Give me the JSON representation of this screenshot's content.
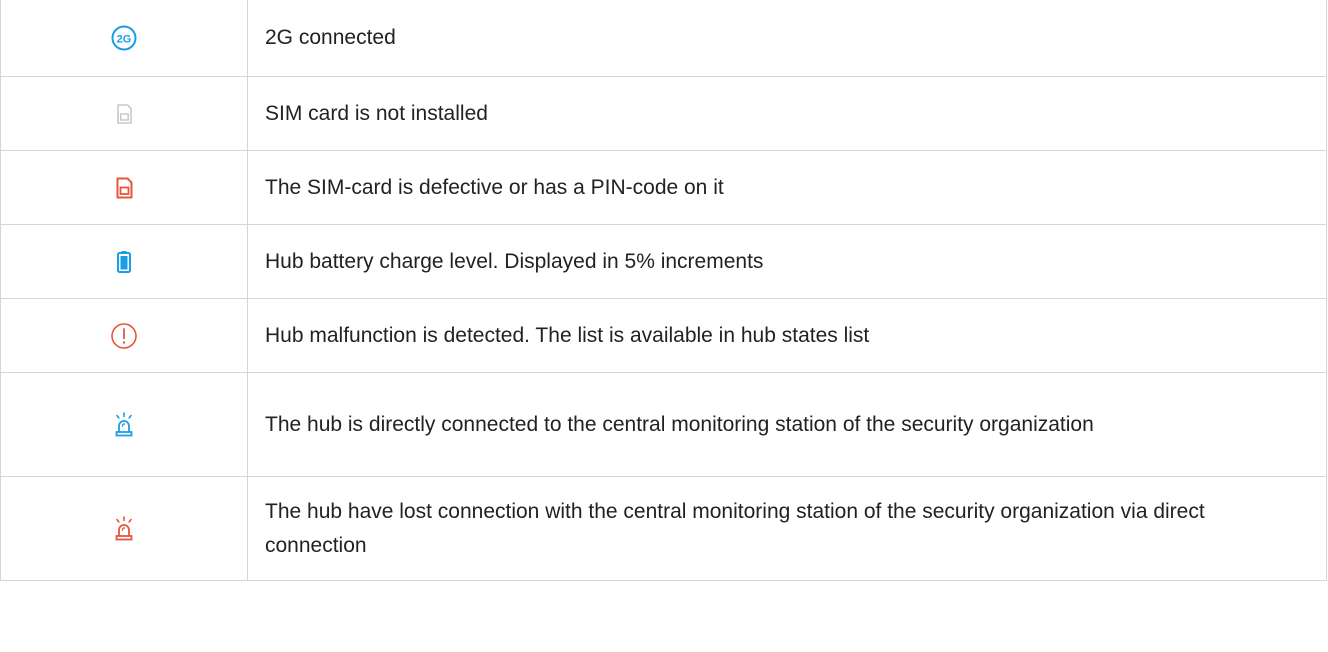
{
  "colors": {
    "blue": "#1a9ee8",
    "red": "#e8553e",
    "gray": "#c8c8c8",
    "border": "#d6d6d6",
    "text": "#222222"
  },
  "rows": [
    {
      "icon": "2g-icon",
      "icon_text": "2G",
      "text": "2G connected"
    },
    {
      "icon": "sim-card-not-installed-icon",
      "text": "SIM card is not installed"
    },
    {
      "icon": "sim-card-defective-icon",
      "text": "The SIM-card is defective or has a PIN-code on it"
    },
    {
      "icon": "battery-icon",
      "text": "Hub battery charge level. Displayed in 5% increments"
    },
    {
      "icon": "malfunction-icon",
      "text": "Hub malfunction is detected. The list is available in hub states list"
    },
    {
      "icon": "monitoring-station-connected-icon",
      "text": "The hub is directly connected to the central monitoring station of the security organization"
    },
    {
      "icon": "monitoring-station-lost-icon",
      "text": "The hub have lost connection with the central monitoring station of the security organization via direct connection"
    }
  ]
}
